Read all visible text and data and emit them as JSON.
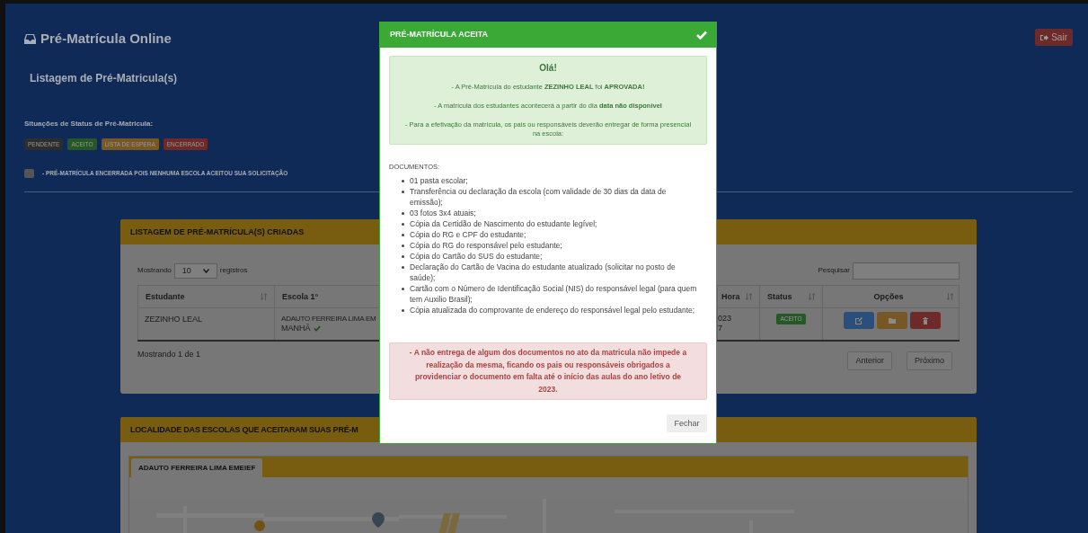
{
  "header": {
    "title": "Pré-Matrícula Online",
    "logout_button": "Sair"
  },
  "page_title": "Listagem de Pré-Matricula(s)",
  "status_legend": {
    "label": "Situações de Status de Pré-Matricula:",
    "badges": [
      {
        "text": "PENDENTE",
        "color": "#2d2d2d"
      },
      {
        "text": "ACEITO",
        "color": "#265726"
      },
      {
        "text": "LISTA DE ESPERA",
        "color": "#785727"
      },
      {
        "text": "ENCERRADO",
        "color": "#6d2a28"
      }
    ]
  },
  "closed_note": "- PRÉ-MATRÍCULA ENCERRADA POIS NENHUMA ESCOLA ACEITOU SUA SOLICITAÇÃO",
  "listing": {
    "title": "LISTAGEM DE PRÉ-MATRÍCULA(S) CRIADAS",
    "length_prefix": "Mostrando",
    "length_value": "10",
    "length_suffix": "registros",
    "search_label": "Pesquisar",
    "columns": [
      {
        "label": "Estudante",
        "sortable": true
      },
      {
        "label": "Escola 1°",
        "sortable": false
      },
      {
        "label": "Hora",
        "sortable": true
      },
      {
        "label": "Status",
        "sortable": true
      },
      {
        "label": "Opções",
        "sortable": true
      }
    ],
    "rows": [
      {
        "student": "ZEZINHO LEAL",
        "school": [
          "ADAUTO FERREIRA LIMA EM",
          "MANHÃ"
        ],
        "school_confirmed": true,
        "time": [
          "023",
          "7"
        ],
        "status": {
          "text": "ACEITO",
          "color": "#265726"
        },
        "actions": [
          {
            "kind": "edit"
          },
          {
            "kind": "folder"
          },
          {
            "kind": "delete"
          }
        ]
      }
    ],
    "info": "Mostrando 1 de 1",
    "pagination": [
      "Anterior",
      "Próximo"
    ]
  },
  "locations": {
    "title": "LOCALIDADE DAS ESCOLAS QUE ACEITARAM SUAS PRÉ-M",
    "tabs": [
      {
        "label": "ADAUTO FERREIRA LIMA EMEIEF",
        "selected": true
      }
    ]
  },
  "modal": {
    "title": "PRÉ-MATRÍCULA ACEITA",
    "greeting": "Olá!",
    "messages": [
      "- A Pré-Matrícula do estudante **ZEZINHO LEAL** foi **APROVADA!**",
      "- A matrícula dos estudantes acontecerá a partir do dia **data não disponível**",
      "- Para a efetivação da matrícula, os pais ou responsáveis deverão entregar de forma presencial na escola:"
    ],
    "documents_label": "DOCUMENTOS:",
    "documents": [
      "01 pasta escolar;",
      "Transferência ou declaração da escola (com validade de 30 dias da data de emissão);",
      "03 fotos 3x4 atuais;",
      "Cópia da Certidão de Nascimento do estudante legível;",
      "Cópia do RG e CPF do estudante;",
      "Cópia do RG do responsável pelo estudante;",
      "Cópia do Cartão do SUS do estudante;",
      "Declaração do Cartão de Vacina do estudante atualizado (solicitar no posto de saúde);",
      "Cartão com o Número de Identificação Social (NIS) do responsável legal (para quem tem Auxilio Brasil);",
      "Cópia atualizada do comprovante de endereço do responsável legal pelo estudante;"
    ],
    "warning": "- A não entrega de algum dos documentos no ato da matricula não impede a realização da mesma, ficando os pais ou responsáveis obrigados a providenciar o documento em falta até o início das aulas do ano letivo de 2023.",
    "close_button": "Fechar"
  }
}
